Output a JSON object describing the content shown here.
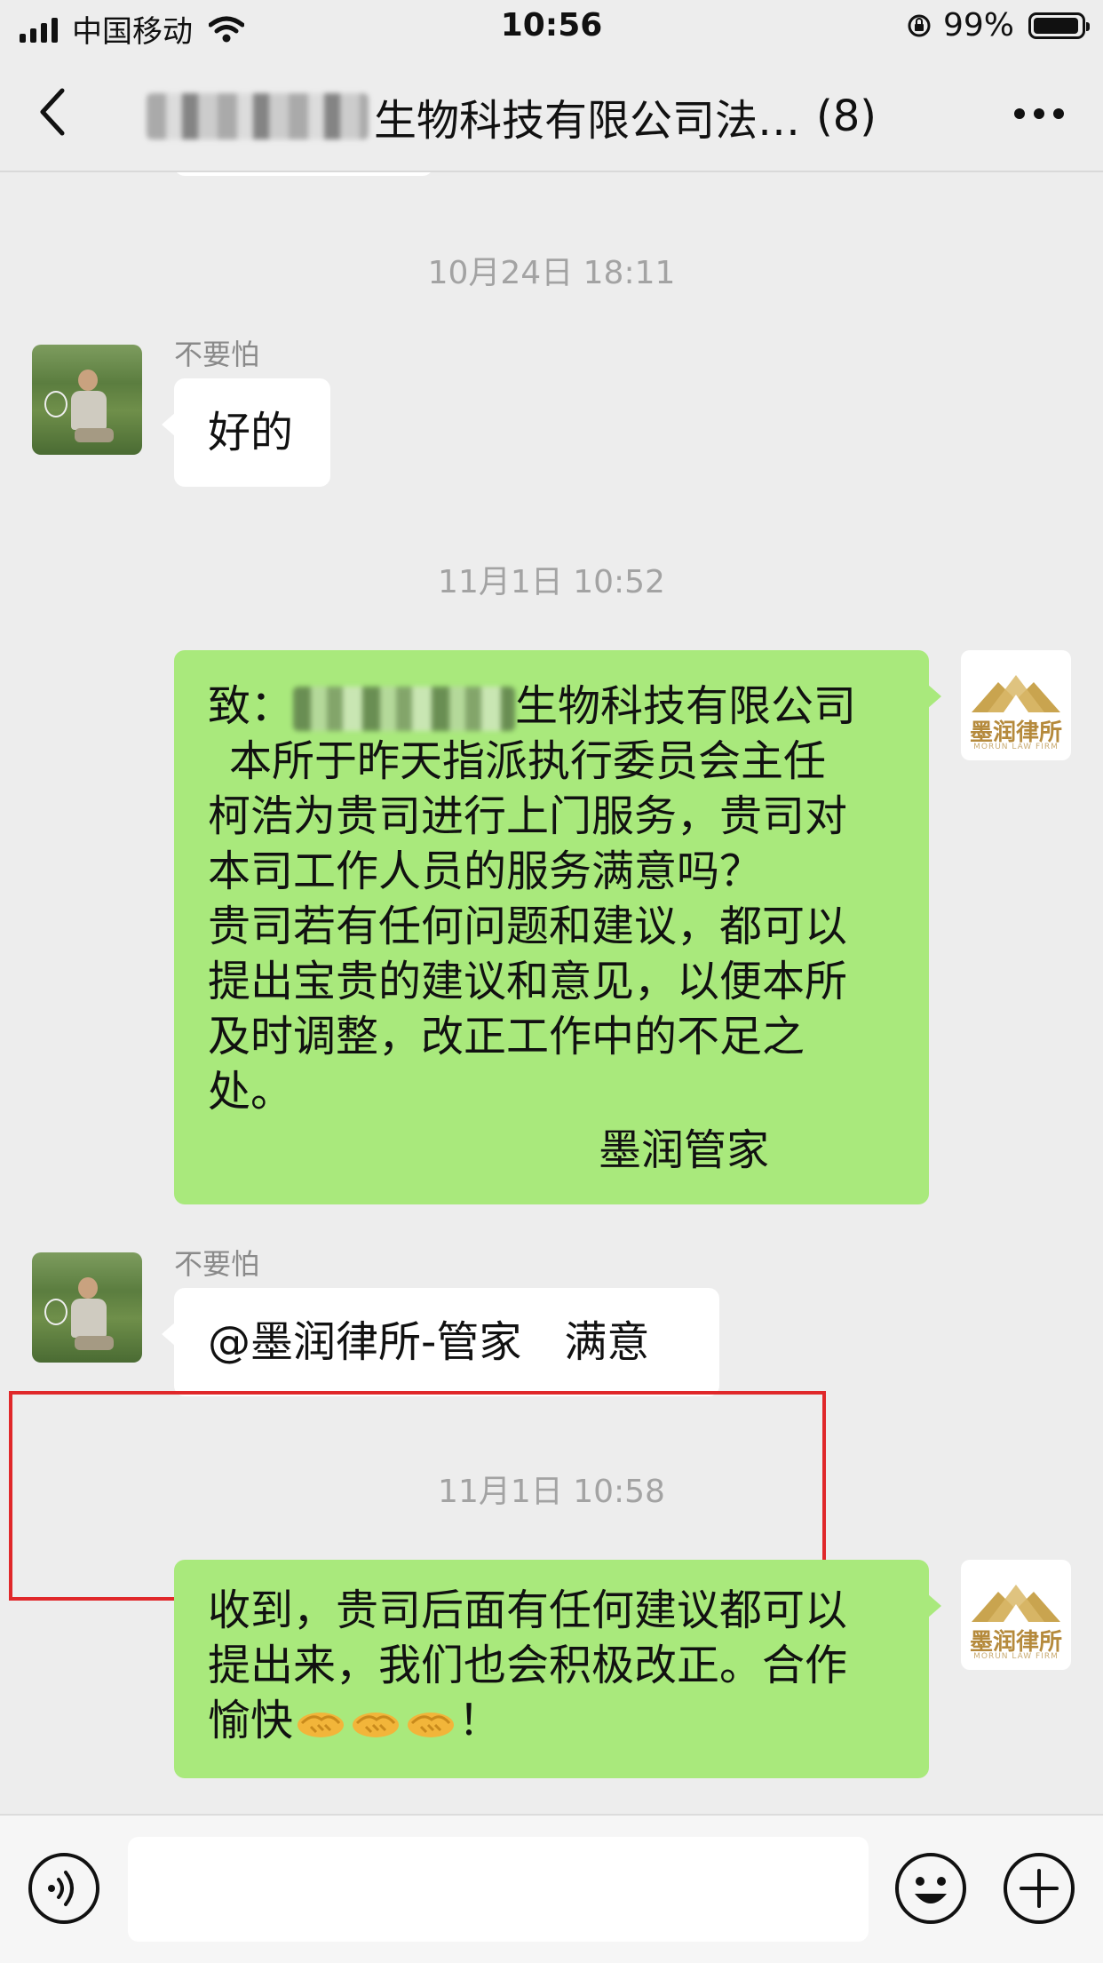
{
  "status_bar": {
    "carrier": "中国移动",
    "time": "10:56",
    "battery": "99%",
    "battery_level": 0.99,
    "signal_bars": 4
  },
  "nav": {
    "title_visible": "生物科技有限公司法…",
    "count": "(8)"
  },
  "messages": [
    {
      "type": "timestamp",
      "text": "10月24日 18:11"
    },
    {
      "type": "incoming",
      "sender": "不要怕",
      "text": "好的"
    },
    {
      "type": "timestamp",
      "text": "11月1日 10:52"
    },
    {
      "type": "outgoing",
      "lines": [
        "致：",
        "生物科技有限公司",
        "本所于昨天指派执行委员会主任",
        "柯浩为贵司进行上门服务，贵司对",
        "本司工作人员的服务满意吗？",
        "贵司若有任何问题和建议，都可以",
        "提出宝贵的建议和意见，以便本所",
        "及时调整，改正工作中的不足之",
        "处。"
      ],
      "signature": "墨润管家"
    },
    {
      "type": "incoming",
      "sender": "不要怕",
      "text": "@墨润律所-管家　满意",
      "highlighted": true
    },
    {
      "type": "timestamp",
      "text": "11月1日 10:58"
    },
    {
      "type": "outgoing",
      "lines": [
        "收到，贵司后面有任何建议都可以",
        "提出来，我们也会积极改正。合作",
        "愉快",
        "！"
      ],
      "emoji": "handshake-icon",
      "emoji_count": 3
    }
  ],
  "logo": {
    "name": "墨润律所",
    "sub": "MORUN LAW FIRM"
  },
  "colors": {
    "outgoing_bubble": "#a9e97c",
    "incoming_bubble": "#ffffff",
    "background": "#ededed",
    "highlight_box": "#e0282a"
  }
}
